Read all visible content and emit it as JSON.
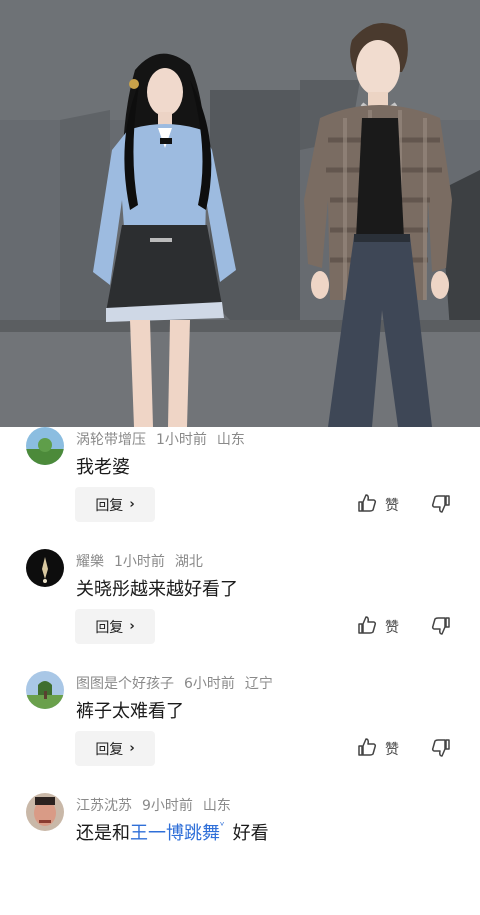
{
  "comments": [
    {
      "username": "涡轮带增压",
      "time": "1小时前",
      "location": "山东",
      "text": "我老婆",
      "reply_label": "回复",
      "like_label": "赞"
    },
    {
      "username": "耀樂",
      "time": "1小时前",
      "location": "湖北",
      "text": "关晓彤越来越好看了",
      "reply_label": "回复",
      "like_label": "赞"
    },
    {
      "username": "图图是个好孩子",
      "time": "6小时前",
      "location": "辽宁",
      "text": "裤子太难看了",
      "reply_label": "回复",
      "like_label": "赞"
    },
    {
      "username": "江苏沈苏",
      "time": "9小时前",
      "location": "山东",
      "text_prefix": "还是和",
      "text_link": "王一博跳舞",
      "text_suffix": "好看"
    }
  ],
  "icons": {
    "reply_chevron": "chevron-right-icon",
    "like": "thumb-up-icon",
    "dislike": "thumb-down-icon",
    "search_mark": "search-icon"
  },
  "colors": {
    "link": "#2f6fd8",
    "meta": "#8a8a8a",
    "button_bg": "#f3f3f3"
  }
}
